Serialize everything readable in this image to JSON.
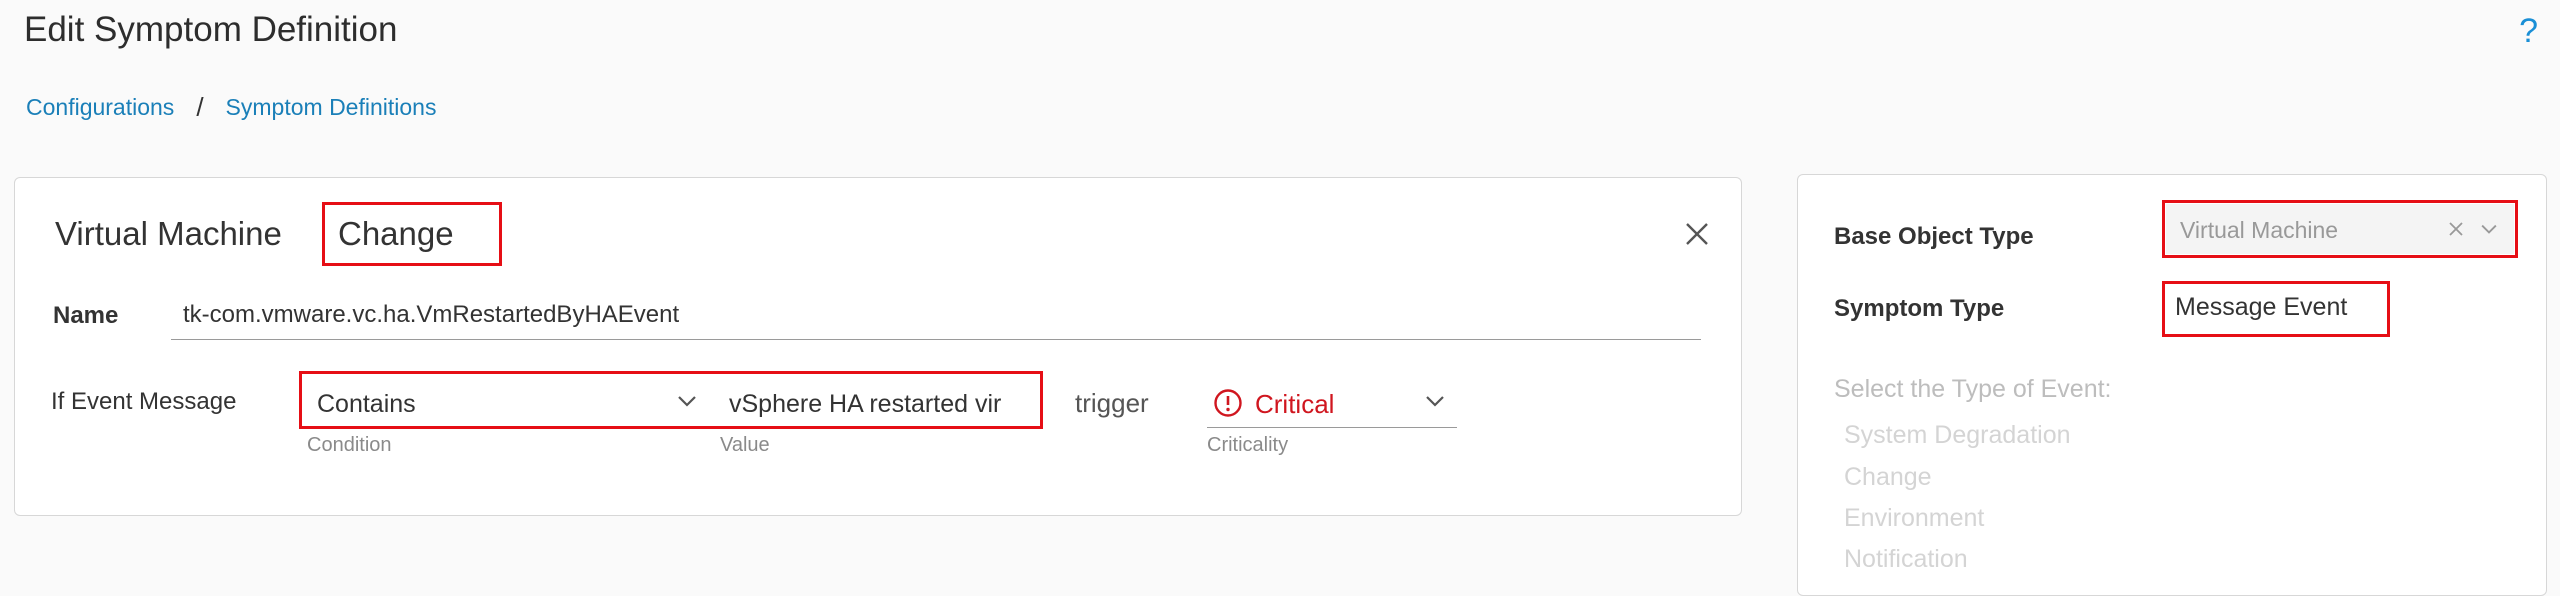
{
  "header": {
    "title": "Edit Symptom Definition",
    "help_icon": "?"
  },
  "breadcrumb": {
    "items": [
      "Configurations",
      "Symptom Definitions"
    ],
    "separator": "/"
  },
  "left_card": {
    "object_type": "Virtual Machine",
    "change_label": "Change",
    "name_label": "Name",
    "name_value": "tk-com.vmware.vc.ha.VmRestartedByHAEvent",
    "if_event_label": "If Event Message",
    "condition_value": "Contains",
    "condition_helper": "Condition",
    "value_text": "vSphere HA restarted vir",
    "value_helper": "Value",
    "trigger_label": "trigger",
    "criticality_value": "Critical",
    "criticality_helper": "Criticality",
    "criticality_color": "#d0161f"
  },
  "right_card": {
    "base_object_type_label": "Base Object Type",
    "base_object_type_value": "Virtual Machine",
    "symptom_type_label": "Symptom Type",
    "symptom_type_value": "Message Event",
    "select_event_label": "Select the Type of Event:",
    "event_types": [
      "System Degradation",
      "Change",
      "Environment",
      "Notification"
    ]
  },
  "colors": {
    "highlight": "#e60e15",
    "link": "#1a7fb8"
  }
}
